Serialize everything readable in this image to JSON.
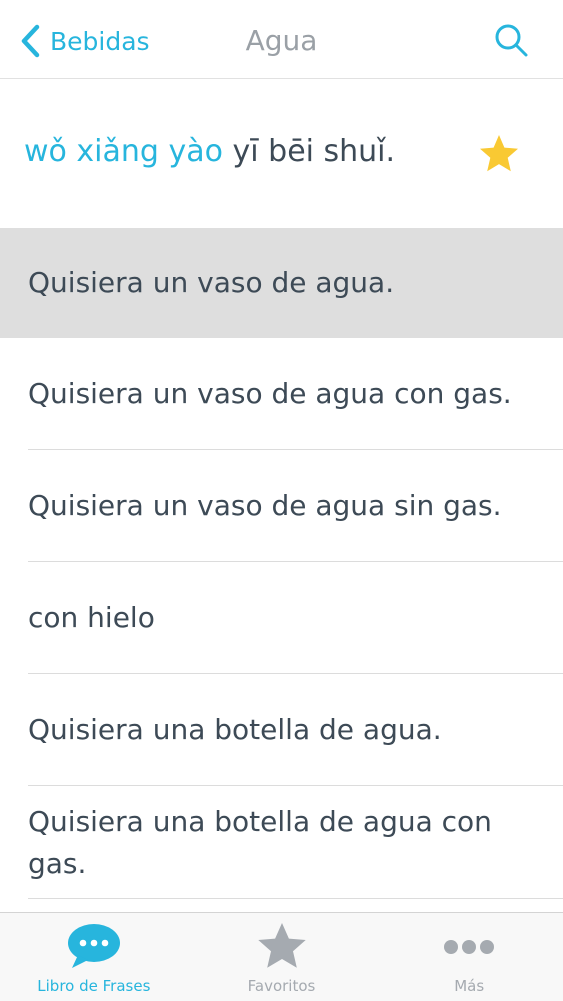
{
  "nav": {
    "back_label": "Bebidas",
    "title": "Agua"
  },
  "phrase": {
    "pinyin_highlight": "wǒ xiǎng yào",
    "pinyin_rest": "yī bēi shuǐ.",
    "favorite": true
  },
  "phrases": [
    "Quisiera un vaso de agua.",
    "Quisiera un vaso de agua con gas.",
    "Quisiera un vaso de agua sin gas.",
    "con hielo",
    "Quisiera una botella de agua.",
    "Quisiera una botella de agua con gas."
  ],
  "selected_index": 0,
  "tabs": [
    {
      "label": "Libro de Frases",
      "icon": "chat-bubble-icon",
      "active": true
    },
    {
      "label": "Favoritos",
      "icon": "star-icon",
      "active": false
    },
    {
      "label": "Más",
      "icon": "more-dots-icon",
      "active": false
    }
  ],
  "colors": {
    "accent": "#27b5dd",
    "text": "#3d4a56",
    "title_gray": "#9aa0a6",
    "selected_row": "#dedede",
    "star": "#f9c933",
    "inactive_tab": "#a5aab0"
  }
}
